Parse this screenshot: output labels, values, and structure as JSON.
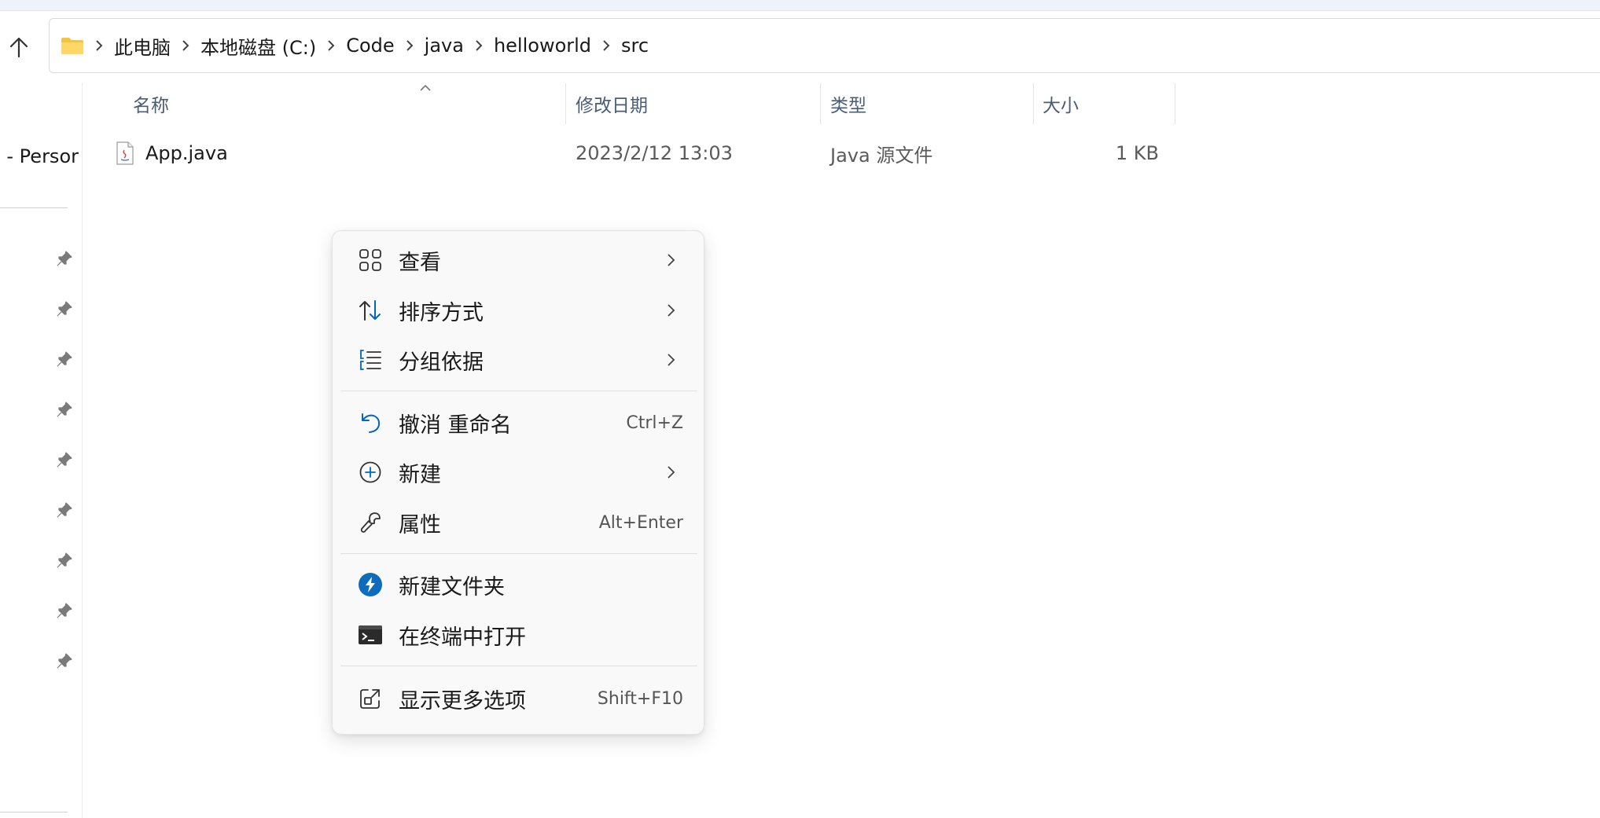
{
  "breadcrumb": {
    "items": [
      "此电脑",
      "本地磁盘 (C:)",
      "Code",
      "java",
      "helloworld",
      "src"
    ]
  },
  "sidebar": {
    "partial_item_label": "e - Persor",
    "pinned_count": 9
  },
  "columns": {
    "name": "名称",
    "modified": "修改日期",
    "type": "类型",
    "size": "大小"
  },
  "files": [
    {
      "name": "App.java",
      "modified": "2023/2/12 13:03",
      "type": "Java 源文件",
      "size": "1 KB",
      "icon": "java-file-icon"
    }
  ],
  "context_menu": {
    "items": [
      {
        "label": "查看",
        "icon": "grid-view-icon",
        "submenu": true
      },
      {
        "label": "排序方式",
        "icon": "sort-icon",
        "submenu": true
      },
      {
        "label": "分组依据",
        "icon": "group-by-icon",
        "submenu": true
      },
      {
        "label": "撤消 重命名",
        "icon": "undo-icon",
        "shortcut": "Ctrl+Z"
      },
      {
        "label": "新建",
        "icon": "new-plus-icon",
        "submenu": true
      },
      {
        "label": "属性",
        "icon": "wrench-icon",
        "shortcut": "Alt+Enter"
      },
      {
        "label": "新建文件夹",
        "icon": "power-automate-icon"
      },
      {
        "label": "在终端中打开",
        "icon": "terminal-icon"
      },
      {
        "label": "显示更多选项",
        "icon": "more-options-icon",
        "shortcut": "Shift+F10"
      }
    ]
  },
  "colors": {
    "accent": "#0067c0",
    "folder_yellow": "#f5c342",
    "header_text": "#4a5d75"
  }
}
